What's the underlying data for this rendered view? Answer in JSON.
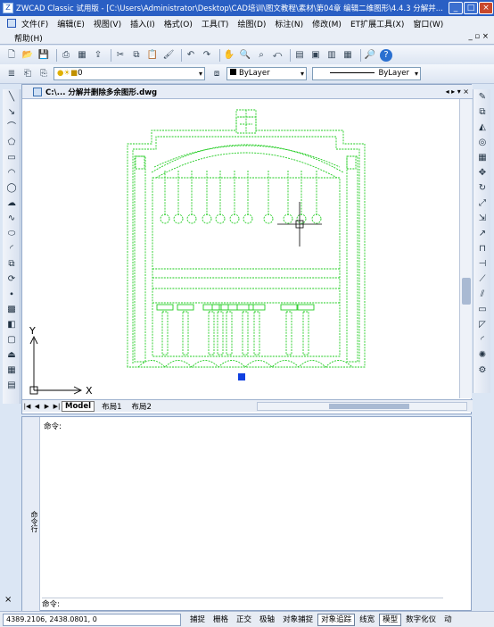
{
  "title": {
    "text": "ZWCAD Classic 试用版 - [C:\\Users\\Administrator\\Desktop\\CAD培训\\图文教程\\素材\\第04章 编辑二维图形\\4.4.3  分解并..."
  },
  "menu": {
    "row1": [
      "文件(F)",
      "编辑(E)",
      "视图(V)",
      "插入(I)",
      "格式(O)",
      "工具(T)",
      "绘图(D)",
      "标注(N)",
      "修改(M)",
      "ET扩展工具(X)",
      "窗口(W)"
    ],
    "row2": [
      "帮助(H)"
    ]
  },
  "layer": {
    "name": "0",
    "color": "ByLayer",
    "linetype": "ByLayer"
  },
  "document": {
    "tab_title": "C:\\...  分解并删除多余图形.dwg"
  },
  "ucs": {
    "x_label": "X",
    "y_label": "Y"
  },
  "layouts": [
    "Model",
    "布局1",
    "布局2"
  ],
  "command": {
    "side_label": "命令行",
    "history": "命令:",
    "prompt": "命令:"
  },
  "status": {
    "coords": "4389.2106,  2438.0801,  0",
    "buttons": [
      {
        "label": "捕捉",
        "on": false
      },
      {
        "label": "栅格",
        "on": false
      },
      {
        "label": "正交",
        "on": false
      },
      {
        "label": "极轴",
        "on": false
      },
      {
        "label": "对象捕捉",
        "on": false
      },
      {
        "label": "对象追踪",
        "on": true
      },
      {
        "label": "线宽",
        "on": false
      },
      {
        "label": "模型",
        "on": true
      },
      {
        "label": "数字化仪",
        "on": false
      },
      {
        "label": "动",
        "on": false
      }
    ]
  },
  "colors": {
    "drawing": "#22cc22",
    "grip": "#1040e0",
    "titlebar": "#2a5fc4"
  }
}
